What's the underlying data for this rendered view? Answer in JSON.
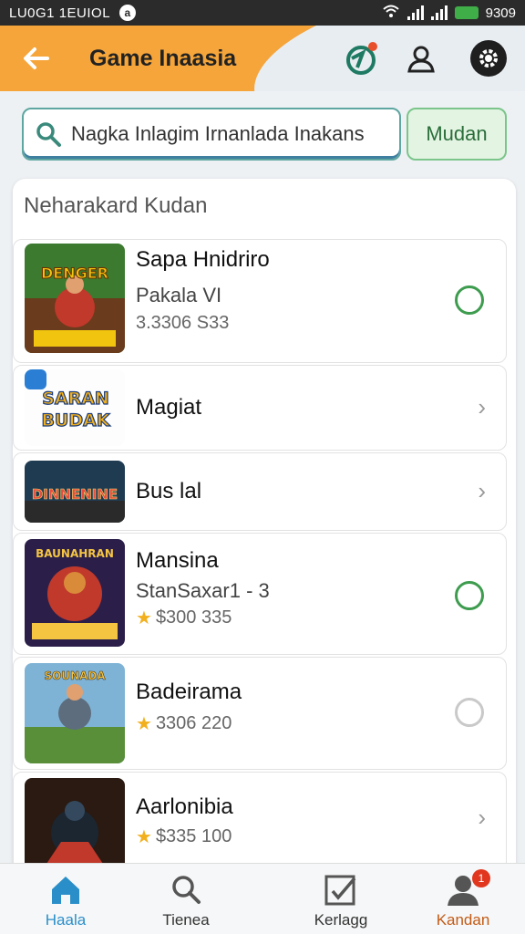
{
  "status_bar": {
    "left_text": "LU0G1 1EUIOL",
    "time": "9309"
  },
  "app_bar": {
    "title": "Game Inaasia"
  },
  "search": {
    "placeholder": "Nagka Inlagim Irnanlada Inakans",
    "button_label": "Mudan"
  },
  "section": {
    "title": "Neharakard Kudan"
  },
  "games": [
    {
      "name": "Sapa Hnidriro",
      "subtitle": "Pakala VI",
      "price": "3.3306 S33",
      "has_star": false,
      "control": "radio-on",
      "thumb_text": "DENGER"
    },
    {
      "name": "Magiat",
      "subtitle": "",
      "price": "",
      "has_star": false,
      "control": "chevron",
      "thumb_text": "SARAN BUDAK"
    },
    {
      "name": "Bus lal",
      "subtitle": "",
      "price": "",
      "has_star": false,
      "control": "chevron",
      "thumb_text": "DINNENINE"
    },
    {
      "name": "Mansina",
      "subtitle": "StanSaxar1 - 3",
      "price": "$300 335",
      "has_star": true,
      "control": "radio-on",
      "thumb_text": "BAUNAHRAN"
    },
    {
      "name": "Badeirama",
      "subtitle": "",
      "price": "3306 220",
      "has_star": true,
      "control": "radio-off",
      "thumb_text": "SOUNADA"
    },
    {
      "name": "Aarlonibia",
      "subtitle": "",
      "price": "$335 100",
      "has_star": true,
      "control": "chevron",
      "thumb_text": ""
    }
  ],
  "bottom_nav": [
    {
      "label": "Haala",
      "icon": "home-icon"
    },
    {
      "label": "Tienea",
      "icon": "search-icon"
    },
    {
      "label": "Kerlagg",
      "icon": "edit-icon"
    },
    {
      "label": "Kandan",
      "icon": "profile-icon",
      "badge": "1"
    }
  ],
  "colors": {
    "accent_orange": "#f5a53a",
    "green": "#3e9c4f",
    "active_blue": "#2a8fc9"
  }
}
